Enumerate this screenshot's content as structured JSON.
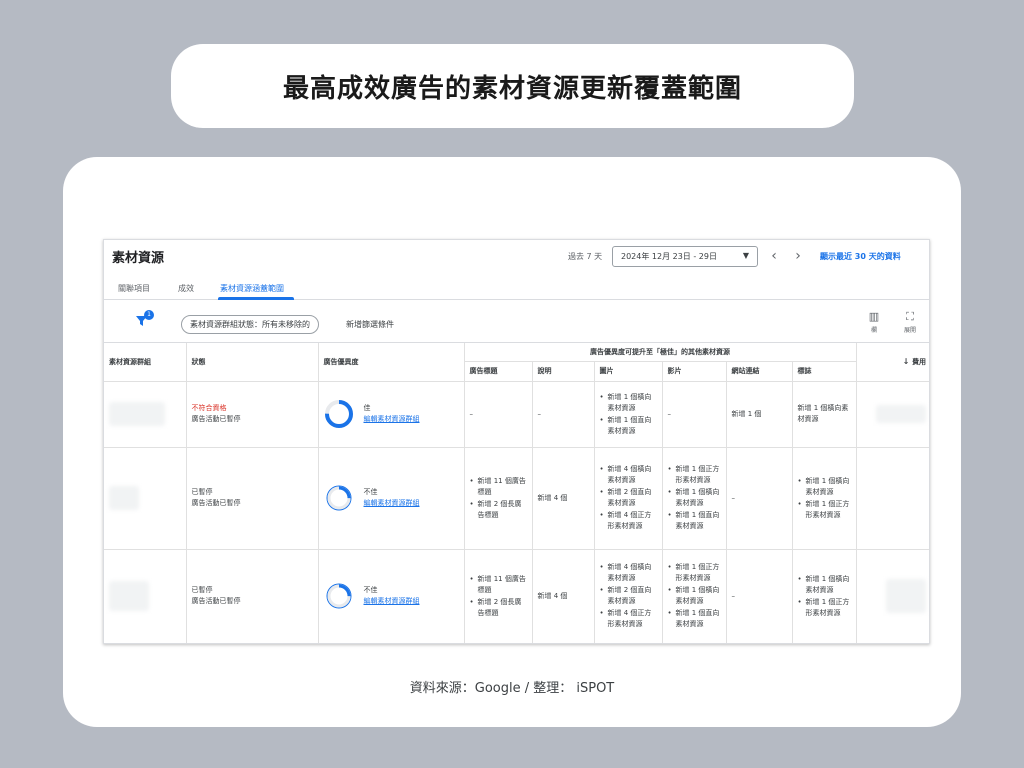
{
  "slide_title": "最高成效廣告的素材資源更新覆蓋範圍",
  "caption": "資料來源：Google / 整理： iSPOT",
  "screenshot": {
    "page_title": "素材資源",
    "period_label": "過去 7 天",
    "date_range": "2024年 12月 23日 - 29日",
    "show_link": "顯示最近 30 天的資料",
    "tabs": [
      {
        "label": "關聯項目",
        "active": false
      },
      {
        "label": "成效",
        "active": false
      },
      {
        "label": "素材資源涵蓋範圍",
        "active": true
      }
    ],
    "filter": {
      "badge": "1",
      "chip": "素材資源群組狀態：所有未移除的",
      "add_filter": "新增篩選條件"
    },
    "tools": [
      {
        "icon": "columns-icon",
        "label": "欄"
      },
      {
        "icon": "expand-icon",
        "label": "展開"
      }
    ],
    "table": {
      "headers": {
        "asset_group": "素材資源群組",
        "status": "狀態",
        "ad_strength": "廣告優異度",
        "group": "廣告優異度可提升至「極佳」的其他素材資源",
        "headlines": "廣告標題",
        "descriptions": "說明",
        "images": "圖片",
        "videos": "影片",
        "sitelinks": "網站連結",
        "logos": "標誌",
        "cost": "費用"
      },
      "rows": [
        {
          "status_lines": [
            "不符合資格",
            "廣告活動已暫停"
          ],
          "status_red": true,
          "strength_label": "佳",
          "strength_link": "編輯素材資源群組",
          "strength_fraction": 0.75,
          "headlines": [],
          "headlines_text": "–",
          "descriptions": "–",
          "images": [
            "新增 1 個橫向素材資源",
            "新增 1 個直向素材資源"
          ],
          "videos_text": "–",
          "videos": [],
          "sitelinks": "新增 1 個",
          "logos_text": "新增 1 個橫向素材資源",
          "logos": []
        },
        {
          "status_lines": [
            "已暫停",
            "廣告活動已暫停"
          ],
          "status_red": false,
          "strength_label": "不佳",
          "strength_link": "編輯素材資源群組",
          "strength_fraction": 0.25,
          "headlines": [
            "新增 11 個廣告標題",
            "新增 2 個長廣告標題"
          ],
          "descriptions": "新增 4 個",
          "images": [
            "新增 4 個橫向素材資源",
            "新增 2 個直向素材資源",
            "新增 4 個正方形素材資源"
          ],
          "videos": [
            "新增 1 個正方形素材資源",
            "新增 1 個橫向素材資源",
            "新增 1 個直向素材資源"
          ],
          "sitelinks": "–",
          "logos": [
            "新增 1 個橫向素材資源",
            "新增 1 個正方形素材資源"
          ]
        },
        {
          "status_lines": [
            "已暫停",
            "廣告活動已暫停"
          ],
          "status_red": false,
          "strength_label": "不佳",
          "strength_link": "編輯素材資源群組",
          "strength_fraction": 0.25,
          "headlines": [
            "新增 11 個廣告標題",
            "新增 2 個長廣告標題"
          ],
          "descriptions": "新增 4 個",
          "images": [
            "新增 4 個橫向素材資源",
            "新增 2 個直向素材資源",
            "新增 4 個正方形素材資源"
          ],
          "videos": [
            "新增 1 個正方形素材資源",
            "新增 1 個橫向素材資源",
            "新增 1 個直向素材資源"
          ],
          "sitelinks": "–",
          "logos": [
            "新增 1 個橫向素材資源",
            "新增 1 個正方形素材資源"
          ]
        }
      ]
    },
    "colors": {
      "accent": "#1a73e8",
      "error": "#d93025",
      "ring_track": "#e8eaed"
    }
  }
}
